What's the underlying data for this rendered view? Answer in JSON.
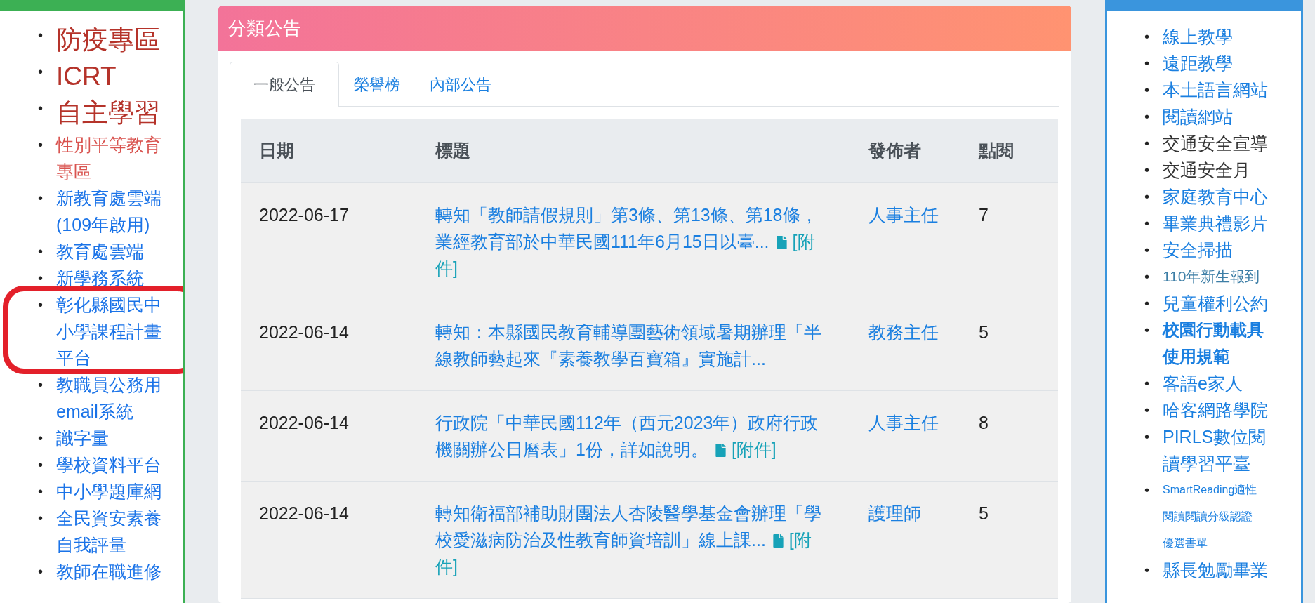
{
  "left_links": [
    {
      "marker": "•",
      "label": "防疫專區",
      "kind": "featured",
      "circled": false
    },
    {
      "marker": "•",
      "label": "ICRT",
      "kind": "featured",
      "circled": false
    },
    {
      "marker": "•",
      "label": "自主學習",
      "kind": "featured",
      "circled": false
    },
    {
      "marker": "•",
      "label": "性別平等教育專區",
      "kind": "highlight",
      "circled": false
    },
    {
      "marker": "•",
      "label": "新教育處雲端(109年啟用)",
      "kind": "link",
      "circled": false
    },
    {
      "marker": "•",
      "label": "教育處雲端",
      "kind": "link",
      "circled": false
    },
    {
      "marker": "•",
      "label": "新學務系統",
      "kind": "link",
      "circled": false
    },
    {
      "marker": "•",
      "label": "彰化縣國民中小學課程計畫平台",
      "kind": "link",
      "circled": true
    },
    {
      "marker": "•",
      "label": "教職員公務用email系統",
      "kind": "link",
      "circled": false
    },
    {
      "marker": "•",
      "label": "識字量",
      "kind": "link",
      "circled": false
    },
    {
      "marker": "•",
      "label": "學校資料平台",
      "kind": "link",
      "circled": false
    },
    {
      "marker": "•",
      "label": "中小學題庫網",
      "kind": "link",
      "circled": false
    },
    {
      "marker": "•",
      "label": "全民資安素養自我評量",
      "kind": "link",
      "circled": false
    },
    {
      "marker": "•",
      "label": "教師在職進修",
      "kind": "link",
      "circled": false
    }
  ],
  "announcements": {
    "title": "分類公告",
    "tabs": [
      {
        "label": "一般公告",
        "selected": true
      },
      {
        "label": "榮譽榜",
        "selected": false
      },
      {
        "label": "內部公告",
        "selected": false
      }
    ],
    "columns": [
      "日期",
      "標題",
      "發佈者",
      "點閱"
    ],
    "rows": [
      {
        "date": "2022-06-17",
        "title": "轉知「教師請假規則」第3條、第13條、第18條，業經教育部於中華民國111年6月15日以臺...",
        "attachment": "[附件]",
        "publisher": "人事主任",
        "views": "7"
      },
      {
        "date": "2022-06-14",
        "title": "轉知：本縣國民教育輔導團藝術領域暑期辦理「半線教師藝起來『素養教學百寶箱』實施計...",
        "publisher": "教務主任",
        "views": "5"
      },
      {
        "date": "2022-06-14",
        "title": "行政院「中華民國112年（西元2023年）政府行政機關辦公日曆表」1份，詳如說明。",
        "attachment": "[附件]",
        "publisher": "人事主任",
        "views": "8"
      },
      {
        "date": "2022-06-14",
        "title": "轉知衛福部補助財團法人杏陵醫學基金會辦理「學校愛滋病防治及性教育師資培訓」線上課...",
        "attachment": "[附件]",
        "publisher": "護理師",
        "views": "5"
      }
    ]
  },
  "right_links": [
    {
      "marker": "•",
      "label": "線上教學",
      "kind": "link"
    },
    {
      "marker": "•",
      "label": "遠距教學",
      "kind": "link"
    },
    {
      "marker": "•",
      "label": "本土語言網站",
      "kind": "link"
    },
    {
      "marker": "•",
      "label": "閱讀網站",
      "kind": "link"
    },
    {
      "marker": "•",
      "label": "交通安全宣導",
      "kind": "plain"
    },
    {
      "marker": "•",
      "label": "交通安全月",
      "kind": "plain"
    },
    {
      "marker": "•",
      "label": "家庭教育中心",
      "kind": "link"
    },
    {
      "marker": "•",
      "label": "畢業典禮影片",
      "kind": "link"
    },
    {
      "marker": "•",
      "label": "安全掃描",
      "kind": "link"
    },
    {
      "marker": "•",
      "label": "110年新生報到",
      "kind": "muted"
    },
    {
      "marker": "•",
      "label": "兒童權利公約",
      "kind": "link"
    },
    {
      "marker": "•",
      "label": "校園行動載具使用規範",
      "kind": "bold"
    },
    {
      "marker": "•",
      "label": "客語e家人",
      "kind": "link"
    },
    {
      "marker": "•",
      "label": "哈客網路學院",
      "kind": "link"
    },
    {
      "marker": "•",
      "label": "PIRLS數位閱讀學習平臺",
      "kind": "link"
    },
    {
      "marker": "•",
      "label": "SmartReading適性閱讀閱讀分級認證優選書單",
      "kind": "small"
    },
    {
      "marker": "•",
      "label": "縣長勉勵畢業",
      "kind": "link"
    }
  ]
}
